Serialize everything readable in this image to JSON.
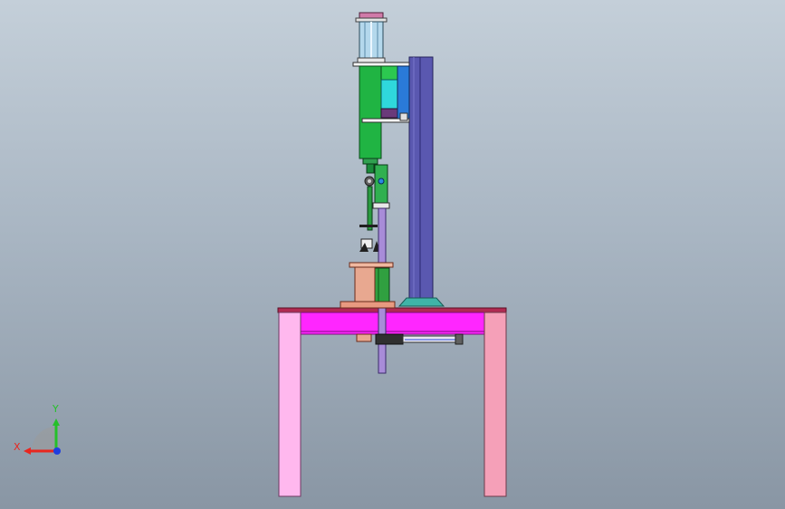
{
  "viewport": {
    "background_top": "#c4cfd9",
    "background_bottom": "#8996a4"
  },
  "triad": {
    "x_label": "X",
    "y_label": "Y",
    "x_color": "#e8261f",
    "y_color": "#25c02a",
    "z_color": "#1f3ee0"
  },
  "colors": {
    "table_top": "#ff26ff",
    "table_leg_left": "#ffb8ee",
    "table_leg_right": "#f5a0b8",
    "column": "#5a58b0",
    "column_base": "#3fb4a8",
    "spindle_body": "#20b443",
    "cylinder_cyan": "#2fd8dc",
    "tube": "#b4d8ec",
    "copper_drum": "#e8a890",
    "purple_rod": "#a88cd8"
  }
}
